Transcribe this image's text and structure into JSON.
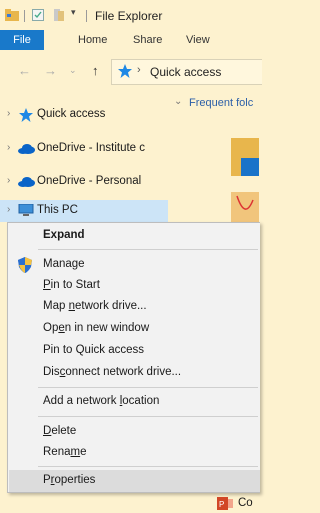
{
  "window": {
    "title": "File Explorer"
  },
  "ribbon": {
    "tabs": [
      "File",
      "Home",
      "Share",
      "View"
    ]
  },
  "address": {
    "location": "Quick access"
  },
  "nav": {
    "items": [
      {
        "label": "Quick access",
        "icon": "quick-access-star-icon"
      },
      {
        "label": "OneDrive - Institute c",
        "icon": "onedrive-cloud-icon"
      },
      {
        "label": "OneDrive - Personal",
        "icon": "onedrive-cloud-icon"
      },
      {
        "label": "This PC",
        "icon": "this-pc-icon"
      }
    ]
  },
  "content": {
    "section_header": "Frequent folc"
  },
  "context_menu": {
    "items": [
      {
        "pre": "",
        "ul": "",
        "post": "Expand"
      },
      {
        "pre": "",
        "ul": "",
        "post": "Manage"
      },
      {
        "pre": "",
        "ul": "P",
        "post": "in to Start"
      },
      {
        "pre": "Map ",
        "ul": "n",
        "post": "etwork drive..."
      },
      {
        "pre": "Op",
        "ul": "e",
        "post": "n in new window"
      },
      {
        "pre": "",
        "ul": "",
        "post": "Pin to Quick access"
      },
      {
        "pre": "Dis",
        "ul": "c",
        "post": "onnect network drive..."
      },
      {
        "pre": "Add a network ",
        "ul": "l",
        "post": "ocation"
      },
      {
        "pre": "",
        "ul": "D",
        "post": "elete"
      },
      {
        "pre": "Rena",
        "ul": "m",
        "post": "e"
      },
      {
        "pre": "P",
        "ul": "r",
        "post": "operties"
      }
    ]
  },
  "bottom_item": {
    "label": "Co"
  },
  "colors": {
    "accent": "#1979ca",
    "background": "#fdf2cf",
    "selection": "#cce4f7"
  }
}
